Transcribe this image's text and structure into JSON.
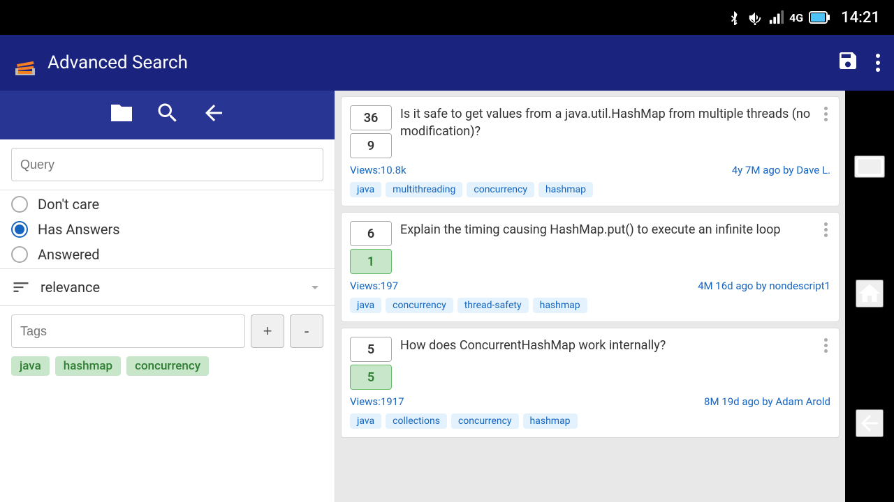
{
  "statusBar": {
    "time": "14:21",
    "icons": [
      "bluetooth",
      "silent",
      "signal",
      "battery"
    ]
  },
  "appBar": {
    "title": "Advanced Search",
    "saveLabel": "💾",
    "menuLabel": "⋮"
  },
  "leftPanel": {
    "toolbar": {
      "folderIcon": "📁",
      "searchIcon": "🔍",
      "backIcon": "↩"
    },
    "queryInput": {
      "placeholder": "Query",
      "value": ""
    },
    "radioOptions": [
      {
        "id": "dont-care",
        "label": "Don't care",
        "selected": false
      },
      {
        "id": "has-answers",
        "label": "Has Answers",
        "selected": true
      },
      {
        "id": "answered",
        "label": "Answered",
        "selected": false
      }
    ],
    "sort": {
      "label": "relevance"
    },
    "tagsInput": {
      "placeholder": "Tags",
      "value": ""
    },
    "addTagLabel": "+",
    "removeTagLabel": "-",
    "selectedTags": [
      "java",
      "hashmap",
      "concurrency"
    ]
  },
  "questions": [
    {
      "votes": "36",
      "answers": "9",
      "answersAccepted": false,
      "title": "Is it safe to get values from a java.util.HashMap from multiple threads (no modification)?",
      "views": "Views:10.8k",
      "timeAuthor": "4y 7M ago by Dave L.",
      "tags": [
        "java",
        "multithreading",
        "concurrency",
        "hashmap"
      ],
      "more": "⋮"
    },
    {
      "votes": "6",
      "answers": "1",
      "answersAccepted": true,
      "title": "Explain the timing causing HashMap.put() to execute an infinite loop",
      "views": "Views:197",
      "timeAuthor": "4M 16d ago by nondescript1",
      "tags": [
        "java",
        "concurrency",
        "thread-safety",
        "hashmap"
      ],
      "more": "⋮"
    },
    {
      "votes": "5",
      "answers": "5",
      "answersAccepted": true,
      "title": "How does ConcurrentHashMap work internally?",
      "views": "Views:1917",
      "timeAuthor": "8M 19d ago by Adam Arold",
      "tags": [
        "java",
        "collections",
        "concurrency",
        "hashmap"
      ],
      "more": "⋮"
    }
  ],
  "sideNav": {
    "rectangleIcon": "▭",
    "homeIcon": "⌂",
    "backIcon": "←"
  }
}
